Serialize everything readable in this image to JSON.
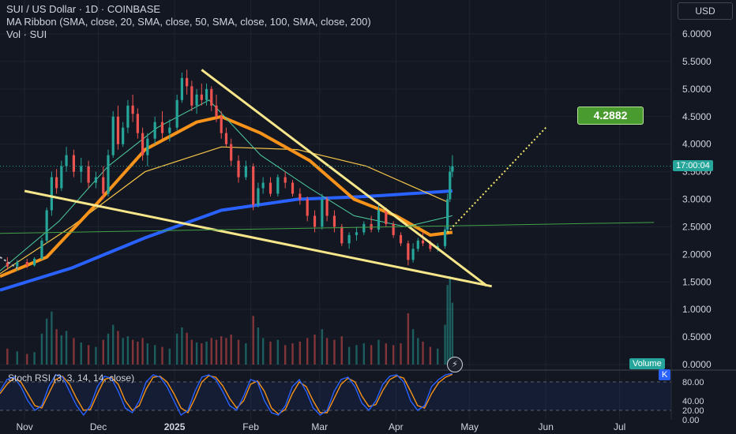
{
  "legend": {
    "title": "SUI / US Dollar · 1D · COINBASE",
    "ma_ribbon": "MA Ribbon (SMA, close, 20, SMA, close, 50, SMA, close, 100, SMA, close, 200)",
    "vol": "Vol · SUI"
  },
  "currency_button": "USD",
  "price_tag": "17:00:04",
  "volume_tag": "Volume",
  "k_tag": "K",
  "target_label": "4.2882",
  "rsi_label": "Stoch RSI (3, 3, 14, 14, close)",
  "flash_icon": "⚡",
  "colors": {
    "background": "#131722",
    "bull": "#26a69a",
    "bear": "#ef5350",
    "ma20": "#4dd0a1",
    "ma50": "#f7931a",
    "ma100": "#f5c54a",
    "ma200": "#2962ff",
    "trendline": "#f7e78a",
    "target_green": "#4a9b2f"
  },
  "chart_data": {
    "type": "candlestick",
    "price_axis": {
      "ticks": [
        "6.0000",
        "5.5000",
        "5.0000",
        "4.5000",
        "4.0000",
        "3.5000",
        "3.0000",
        "2.5000",
        "2.0000",
        "1.5000",
        "1.0000",
        "0.5000",
        "0.0000"
      ],
      "range": [
        0,
        6.2
      ]
    },
    "x_axis_labels": [
      "Nov",
      "Dec",
      "2025",
      "Feb",
      "Mar",
      "Apr",
      "May",
      "Jun",
      "Jul"
    ],
    "x_range": [
      "2024-10-22",
      "2025-07-22"
    ],
    "candles": [
      [
        "2024-10-25",
        1.85,
        1.95,
        1.72,
        1.78
      ],
      [
        "2024-10-29",
        1.78,
        1.9,
        1.7,
        1.86
      ],
      [
        "2024-11-02",
        1.86,
        1.92,
        1.75,
        1.8
      ],
      [
        "2024-11-05",
        1.8,
        1.95,
        1.78,
        1.92
      ],
      [
        "2024-11-08",
        1.92,
        2.3,
        1.9,
        2.25
      ],
      [
        "2024-11-10",
        2.25,
        2.85,
        2.2,
        2.8
      ],
      [
        "2024-11-12",
        2.8,
        3.5,
        2.7,
        3.4
      ],
      [
        "2024-11-14",
        3.4,
        3.55,
        3.1,
        3.2
      ],
      [
        "2024-11-16",
        3.2,
        3.7,
        3.15,
        3.6
      ],
      [
        "2024-11-18",
        3.6,
        3.95,
        3.5,
        3.8
      ],
      [
        "2024-11-21",
        3.8,
        3.9,
        3.4,
        3.5
      ],
      [
        "2024-11-24",
        3.5,
        3.75,
        3.3,
        3.6
      ],
      [
        "2024-11-27",
        3.6,
        3.7,
        3.2,
        3.3
      ],
      [
        "2024-11-30",
        3.3,
        3.5,
        3.2,
        3.4
      ],
      [
        "2024-12-03",
        3.4,
        3.6,
        3.0,
        3.1
      ],
      [
        "2024-12-05",
        3.1,
        3.9,
        3.05,
        3.8
      ],
      [
        "2024-12-07",
        3.8,
        4.6,
        3.75,
        4.5
      ],
      [
        "2024-12-09",
        4.5,
        4.7,
        3.9,
        4.0
      ],
      [
        "2024-12-11",
        4.0,
        4.4,
        3.95,
        4.3
      ],
      [
        "2024-12-13",
        4.3,
        4.8,
        4.2,
        4.7
      ],
      [
        "2024-12-15",
        4.7,
        4.9,
        4.4,
        4.55
      ],
      [
        "2024-12-17",
        4.55,
        4.65,
        4.1,
        4.2
      ],
      [
        "2024-12-19",
        4.2,
        4.3,
        3.7,
        3.8
      ],
      [
        "2024-12-21",
        3.8,
        4.2,
        3.6,
        4.1
      ],
      [
        "2024-12-24",
        4.1,
        4.5,
        4.0,
        4.4
      ],
      [
        "2024-12-27",
        4.4,
        4.6,
        4.1,
        4.2
      ],
      [
        "2024-12-30",
        4.2,
        4.45,
        4.05,
        4.3
      ],
      [
        "2025-01-02",
        4.3,
        4.9,
        4.25,
        4.8
      ],
      [
        "2025-01-04",
        4.8,
        5.3,
        4.75,
        5.2
      ],
      [
        "2025-01-06",
        5.2,
        5.35,
        4.9,
        5.05
      ],
      [
        "2025-01-08",
        5.05,
        5.15,
        4.6,
        4.7
      ],
      [
        "2025-01-10",
        4.7,
        5.0,
        4.55,
        4.9
      ],
      [
        "2025-01-12",
        4.9,
        5.1,
        4.7,
        4.8
      ],
      [
        "2025-01-14",
        4.8,
        5.1,
        4.7,
        5.0
      ],
      [
        "2025-01-16",
        5.0,
        5.05,
        4.6,
        4.7
      ],
      [
        "2025-01-18",
        4.7,
        4.9,
        4.4,
        4.5
      ],
      [
        "2025-01-20",
        4.5,
        4.6,
        4.1,
        4.2
      ],
      [
        "2025-01-22",
        4.2,
        4.3,
        3.95,
        4.0
      ],
      [
        "2025-01-24",
        4.0,
        4.1,
        3.6,
        3.7
      ],
      [
        "2025-01-27",
        3.7,
        3.8,
        3.3,
        3.4
      ],
      [
        "2025-01-30",
        3.4,
        3.7,
        3.35,
        3.6
      ],
      [
        "2025-02-02",
        3.6,
        3.65,
        2.8,
        2.9
      ],
      [
        "2025-02-04",
        2.9,
        3.3,
        2.85,
        3.2
      ],
      [
        "2025-02-06",
        3.2,
        3.4,
        3.1,
        3.3
      ],
      [
        "2025-02-09",
        3.3,
        3.4,
        3.05,
        3.1
      ],
      [
        "2025-02-12",
        3.1,
        3.45,
        3.05,
        3.4
      ],
      [
        "2025-02-15",
        3.4,
        3.5,
        3.2,
        3.3
      ],
      [
        "2025-02-18",
        3.3,
        3.35,
        3.05,
        3.1
      ],
      [
        "2025-02-21",
        3.1,
        3.2,
        2.9,
        3.0
      ],
      [
        "2025-02-24",
        3.0,
        3.05,
        2.6,
        2.7
      ],
      [
        "2025-02-27",
        2.7,
        2.8,
        2.4,
        2.5
      ],
      [
        "2025-03-02",
        2.5,
        3.1,
        2.45,
        3.0
      ],
      [
        "2025-03-04",
        3.0,
        3.05,
        2.6,
        2.7
      ],
      [
        "2025-03-07",
        2.7,
        2.8,
        2.4,
        2.5
      ],
      [
        "2025-03-10",
        2.5,
        2.55,
        2.15,
        2.2
      ],
      [
        "2025-03-13",
        2.2,
        2.4,
        2.1,
        2.35
      ],
      [
        "2025-03-16",
        2.35,
        2.5,
        2.25,
        2.4
      ],
      [
        "2025-03-19",
        2.4,
        2.6,
        2.35,
        2.55
      ],
      [
        "2025-03-22",
        2.55,
        2.7,
        2.4,
        2.45
      ],
      [
        "2025-03-25",
        2.45,
        2.9,
        2.4,
        2.8
      ],
      [
        "2025-03-28",
        2.8,
        2.85,
        2.5,
        2.55
      ],
      [
        "2025-03-31",
        2.55,
        2.6,
        2.3,
        2.35
      ],
      [
        "2025-04-03",
        2.35,
        2.4,
        2.15,
        2.2
      ],
      [
        "2025-04-06",
        2.2,
        2.25,
        1.8,
        1.9
      ],
      [
        "2025-04-08",
        1.9,
        2.2,
        1.85,
        2.1
      ],
      [
        "2025-04-10",
        2.1,
        2.3,
        2.05,
        2.25
      ],
      [
        "2025-04-12",
        2.25,
        2.4,
        2.15,
        2.2
      ],
      [
        "2025-04-15",
        2.2,
        2.25,
        2.05,
        2.1
      ],
      [
        "2025-04-18",
        2.1,
        2.2,
        2.05,
        2.15
      ],
      [
        "2025-04-21",
        2.15,
        2.5,
        2.1,
        2.45
      ],
      [
        "2025-04-22",
        2.45,
        3.1,
        2.4,
        3.0
      ],
      [
        "2025-04-23",
        3.0,
        3.6,
        2.95,
        3.5
      ],
      [
        "2025-04-24",
        3.5,
        3.8,
        3.4,
        3.6
      ]
    ],
    "current_price": 3.6,
    "volume_series": {
      "name": "Volume",
      "scale_max": 1.0,
      "values": [
        0.18,
        0.15,
        0.12,
        0.14,
        0.35,
        0.52,
        0.6,
        0.4,
        0.33,
        0.38,
        0.3,
        0.25,
        0.22,
        0.2,
        0.28,
        0.35,
        0.45,
        0.38,
        0.3,
        0.32,
        0.28,
        0.26,
        0.3,
        0.24,
        0.22,
        0.2,
        0.18,
        0.35,
        0.42,
        0.36,
        0.28,
        0.25,
        0.24,
        0.26,
        0.3,
        0.28,
        0.32,
        0.3,
        0.34,
        0.28,
        0.24,
        0.55,
        0.42,
        0.3,
        0.26,
        0.28,
        0.22,
        0.24,
        0.26,
        0.3,
        0.34,
        0.4,
        0.3,
        0.28,
        0.32,
        0.2,
        0.22,
        0.24,
        0.22,
        0.28,
        0.24,
        0.22,
        0.24,
        0.58,
        0.4,
        0.3,
        0.26,
        0.2,
        0.18,
        0.45,
        0.9,
        1.0,
        0.7
      ]
    },
    "stoch_rsi": {
      "ticks": [
        "80.00",
        "40.00",
        "20.00",
        "0.00"
      ],
      "k": [
        60,
        85,
        90,
        70,
        40,
        20,
        30,
        70,
        95,
        90,
        60,
        30,
        10,
        30,
        70,
        92,
        88,
        60,
        25,
        15,
        40,
        80,
        95,
        90,
        70,
        40,
        10,
        20,
        60,
        90,
        95,
        85,
        60,
        30,
        20,
        50,
        85,
        80,
        40,
        15,
        10,
        30,
        70,
        85,
        60,
        25,
        10,
        20,
        60,
        85,
        90,
        70,
        35,
        20,
        40,
        75,
        92,
        95,
        80,
        40,
        20,
        30,
        70,
        85,
        95,
        98
      ],
      "d": [
        55,
        75,
        88,
        80,
        55,
        30,
        25,
        55,
        85,
        92,
        75,
        45,
        20,
        22,
        55,
        85,
        90,
        75,
        40,
        20,
        30,
        65,
        90,
        92,
        80,
        55,
        25,
        15,
        45,
        80,
        93,
        90,
        72,
        45,
        25,
        40,
        75,
        82,
        60,
        25,
        12,
        22,
        55,
        80,
        70,
        40,
        15,
        15,
        45,
        75,
        88,
        80,
        50,
        28,
        32,
        62,
        85,
        93,
        88,
        60,
        30,
        25,
        55,
        78,
        90,
        96
      ]
    },
    "annotations": [
      {
        "type": "target",
        "value": 4.2882
      }
    ]
  }
}
